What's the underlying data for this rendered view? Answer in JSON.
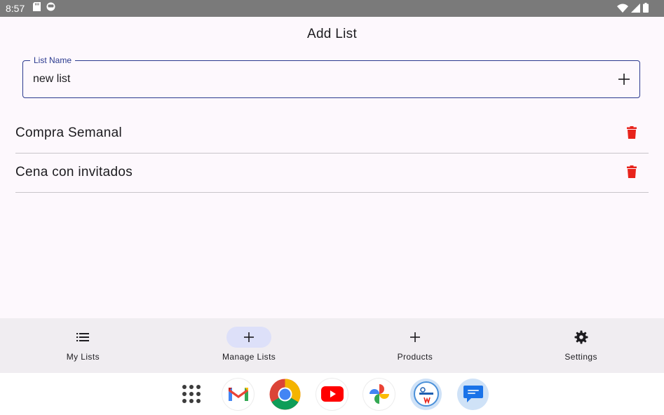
{
  "status_bar": {
    "time": "8:57",
    "left_icons": [
      "sd-card-icon",
      "sync-icon"
    ],
    "right_icons": [
      "wifi-icon",
      "cell-signal-icon",
      "battery-icon"
    ]
  },
  "header": {
    "title": "Add List"
  },
  "list_name_field": {
    "label": "List Name",
    "value": "new list",
    "action_icon": "add-icon"
  },
  "lists": [
    {
      "name": "Compra Semanal",
      "action_icon": "trash-icon"
    },
    {
      "name": "Cena con invitados",
      "action_icon": "trash-icon"
    }
  ],
  "bottom_nav": {
    "items": [
      {
        "label": "My Lists",
        "icon": "list-icon",
        "active": false
      },
      {
        "label": "Manage Lists",
        "icon": "add-icon",
        "active": true
      },
      {
        "label": "Products",
        "icon": "add-icon",
        "active": false
      },
      {
        "label": "Settings",
        "icon": "gear-icon",
        "active": false
      }
    ]
  },
  "dock": {
    "apps": [
      "app-drawer-icon",
      "gmail-icon",
      "chrome-icon",
      "youtube-icon",
      "photos-icon",
      "super-w2-icon",
      "messages-icon"
    ]
  },
  "colors": {
    "accent": "#2b3a8f",
    "delete": "#e8231b",
    "nav_background": "#f0edf1",
    "nav_active_indicator": "#dde0f9",
    "background": "#fdf8fd",
    "status_bar": "#7a7a7a"
  }
}
